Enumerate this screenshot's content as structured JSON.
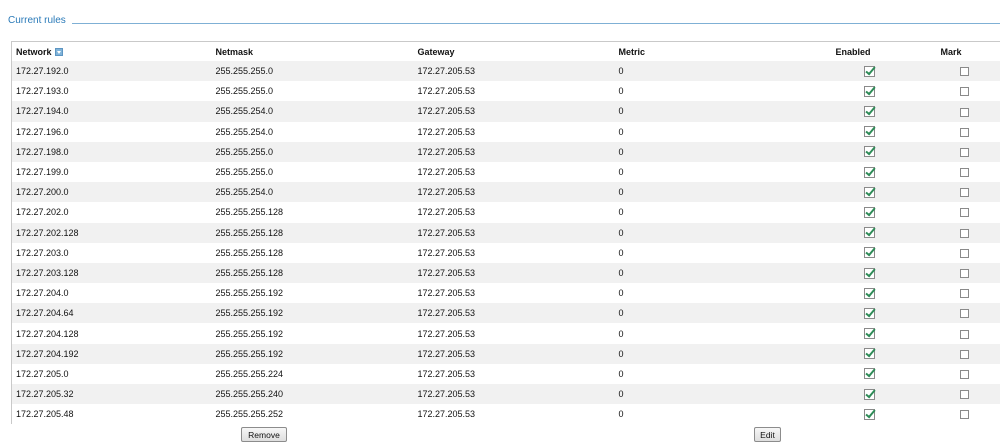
{
  "section": {
    "title": "Current rules"
  },
  "table": {
    "headers": {
      "network": "Network",
      "netmask": "Netmask",
      "gateway": "Gateway",
      "metric": "Metric",
      "enabled": "Enabled",
      "mark": "Mark"
    },
    "sort_icon": "sort-descending-icon",
    "rows": [
      {
        "network": "172.27.192.0",
        "netmask": "255.255.255.0",
        "gateway": "172.27.205.53",
        "metric": "0",
        "enabled": true,
        "mark": false
      },
      {
        "network": "172.27.193.0",
        "netmask": "255.255.255.0",
        "gateway": "172.27.205.53",
        "metric": "0",
        "enabled": true,
        "mark": false
      },
      {
        "network": "172.27.194.0",
        "netmask": "255.255.254.0",
        "gateway": "172.27.205.53",
        "metric": "0",
        "enabled": true,
        "mark": false
      },
      {
        "network": "172.27.196.0",
        "netmask": "255.255.254.0",
        "gateway": "172.27.205.53",
        "metric": "0",
        "enabled": true,
        "mark": false
      },
      {
        "network": "172.27.198.0",
        "netmask": "255.255.255.0",
        "gateway": "172.27.205.53",
        "metric": "0",
        "enabled": true,
        "mark": false
      },
      {
        "network": "172.27.199.0",
        "netmask": "255.255.255.0",
        "gateway": "172.27.205.53",
        "metric": "0",
        "enabled": true,
        "mark": false
      },
      {
        "network": "172.27.200.0",
        "netmask": "255.255.254.0",
        "gateway": "172.27.205.53",
        "metric": "0",
        "enabled": true,
        "mark": false
      },
      {
        "network": "172.27.202.0",
        "netmask": "255.255.255.128",
        "gateway": "172.27.205.53",
        "metric": "0",
        "enabled": true,
        "mark": false
      },
      {
        "network": "172.27.202.128",
        "netmask": "255.255.255.128",
        "gateway": "172.27.205.53",
        "metric": "0",
        "enabled": true,
        "mark": false
      },
      {
        "network": "172.27.203.0",
        "netmask": "255.255.255.128",
        "gateway": "172.27.205.53",
        "metric": "0",
        "enabled": true,
        "mark": false
      },
      {
        "network": "172.27.203.128",
        "netmask": "255.255.255.128",
        "gateway": "172.27.205.53",
        "metric": "0",
        "enabled": true,
        "mark": false
      },
      {
        "network": "172.27.204.0",
        "netmask": "255.255.255.192",
        "gateway": "172.27.205.53",
        "metric": "0",
        "enabled": true,
        "mark": false
      },
      {
        "network": "172.27.204.64",
        "netmask": "255.255.255.192",
        "gateway": "172.27.205.53",
        "metric": "0",
        "enabled": true,
        "mark": false
      },
      {
        "network": "172.27.204.128",
        "netmask": "255.255.255.192",
        "gateway": "172.27.205.53",
        "metric": "0",
        "enabled": true,
        "mark": false
      },
      {
        "network": "172.27.204.192",
        "netmask": "255.255.255.192",
        "gateway": "172.27.205.53",
        "metric": "0",
        "enabled": true,
        "mark": false
      },
      {
        "network": "172.27.205.0",
        "netmask": "255.255.255.224",
        "gateway": "172.27.205.53",
        "metric": "0",
        "enabled": true,
        "mark": false
      },
      {
        "network": "172.27.205.32",
        "netmask": "255.255.255.240",
        "gateway": "172.27.205.53",
        "metric": "0",
        "enabled": true,
        "mark": false
      },
      {
        "network": "172.27.205.48",
        "netmask": "255.255.255.252",
        "gateway": "172.27.205.53",
        "metric": "0",
        "enabled": true,
        "mark": false
      }
    ]
  },
  "buttons": {
    "remove": "Remove",
    "edit": "Edit"
  },
  "colors": {
    "accent": "#2a7ab8",
    "row_alt": "#f1f1f1",
    "check": "#2e8b57"
  }
}
